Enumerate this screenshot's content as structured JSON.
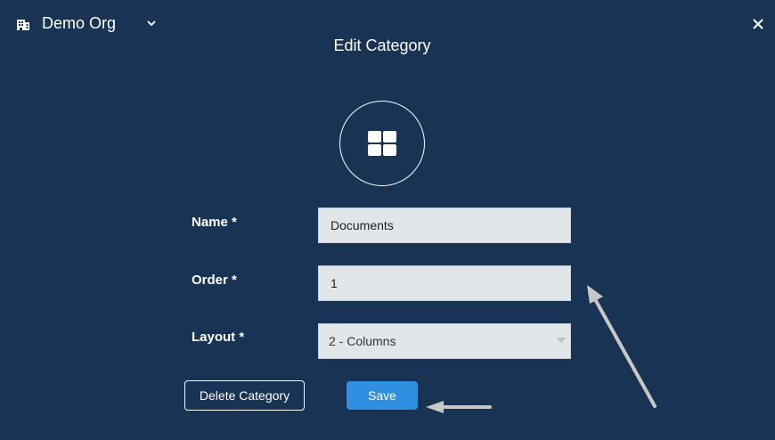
{
  "header": {
    "org_name": "Demo Org",
    "org_icon": "building-icon",
    "dropdown_icon": "chevron-down-icon",
    "close_icon": "close-icon"
  },
  "dialog": {
    "title": "Edit Category",
    "category_icon": "grid-layout-icon"
  },
  "form": {
    "name_label": "Name *",
    "name_value": "Documents",
    "order_label": "Order *",
    "order_value": "1",
    "layout_label": "Layout *",
    "layout_value": "2 - Columns"
  },
  "actions": {
    "delete_label": "Delete Category",
    "save_label": "Save"
  },
  "colors": {
    "background": "#183353",
    "save_button": "#2f8fe0",
    "field_background": "#e1e6ea",
    "annotation_arrow": "#c8c8c8"
  }
}
